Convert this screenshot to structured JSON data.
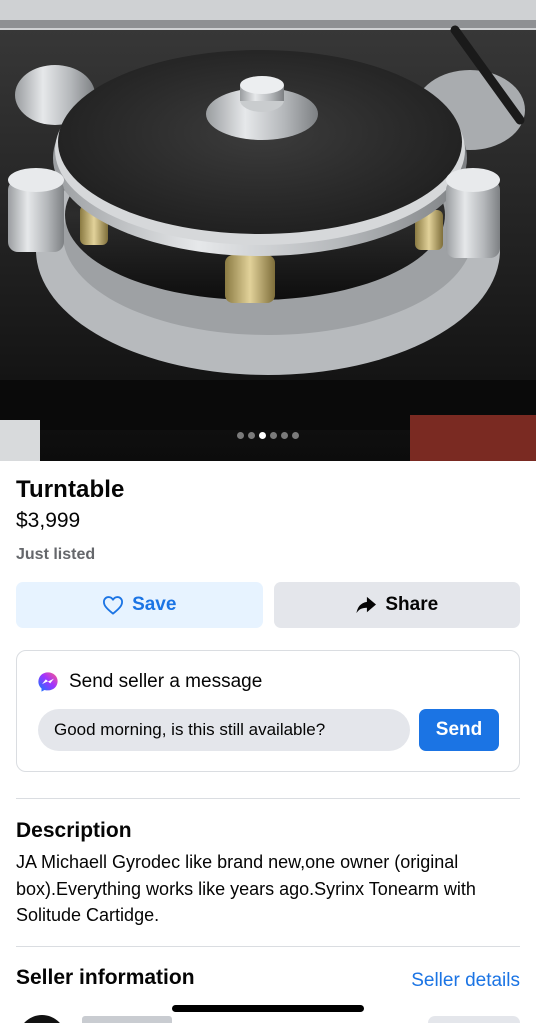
{
  "photo": {
    "alt_subject": "turntable",
    "page_count": 6,
    "active_index": 2
  },
  "listing": {
    "title": "Turntable",
    "price": "$3,999",
    "listed": "Just listed"
  },
  "actions": {
    "save_label": "Save",
    "share_label": "Share"
  },
  "message": {
    "heading": "Send seller a message",
    "input_value": "Good morning, is this still available?",
    "send_label": "Send"
  },
  "description": {
    "heading": "Description",
    "body": "JA Michaell Gyrodec like brand new,one owner (original box).Everything works like years ago.Syrinx Tonearm with Solitude Cartidge."
  },
  "seller": {
    "heading": "Seller information",
    "details_link": "Seller details"
  },
  "colors": {
    "accent": "#1b74e4",
    "save_bg": "#e7f3ff",
    "share_bg": "#e4e6eb",
    "muted_text": "#65676b"
  },
  "icons": {
    "save": "heart-outline-icon",
    "share": "share-arrow-icon",
    "messenger": "messenger-icon"
  }
}
